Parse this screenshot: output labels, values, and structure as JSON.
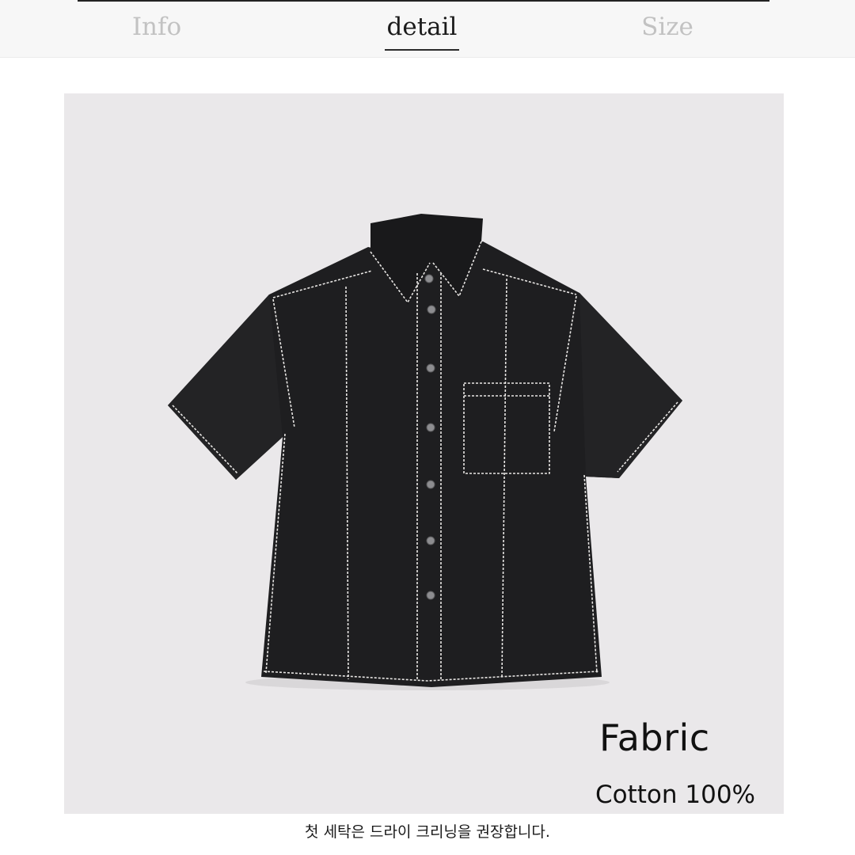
{
  "tabs": {
    "info_label": "Info",
    "detail_label": "detail",
    "size_label": "Size",
    "active": "detail"
  },
  "product": {
    "image_icon": "shirt-photo",
    "fabric_title": "Fabric",
    "fabric_value": "Cotton 100%",
    "care_note": "첫 세탁은 드라이 크리닝을 권장합니다."
  },
  "colors": {
    "tab_inactive": "#c2c2c2",
    "tab_active": "#1b1b1b",
    "photo_background": "#eae8ea",
    "shirt": "#1e1e20",
    "stitching": "#e8e6e4"
  }
}
